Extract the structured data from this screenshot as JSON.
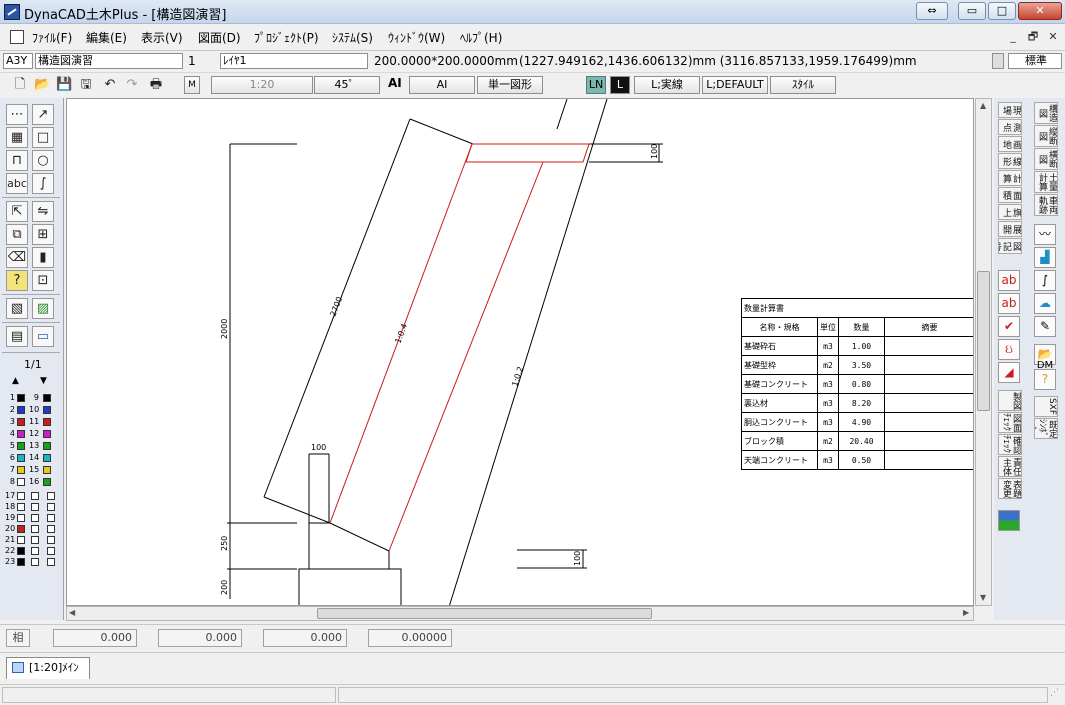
{
  "window": {
    "title": "DynaCAD土木Plus - [構造図演習]",
    "controls": {
      "restore": "⇔",
      "minimize": "▭",
      "maximize": "□",
      "close": "✕"
    }
  },
  "menu": {
    "items": [
      "ﾌｧｲﾙ(F)",
      "編集(E)",
      "表示(V)",
      "図面(D)",
      "ﾌﾟﾛｼﾞｪｸﾄ(P)",
      "ｼｽﾃﾑ(S)",
      "ｳｨﾝﾄﾞｳ(W)",
      "ﾍﾙﾌﾟ(H)"
    ],
    "mdi": [
      "_",
      "🗗",
      "✕"
    ]
  },
  "info": {
    "paper": "A3Y",
    "drawing": "構造図演習",
    "layer_no": "1",
    "layer": "ﾚｲﾔ1",
    "scale_size": "200.0000*200.0000mm",
    "coords": "(1227.949162,1436.606132)mm (3116.857133,1959.176499)mm",
    "style": "標準"
  },
  "toolbar": {
    "m_label": "M",
    "scale": "1:20",
    "angle": "45゜",
    "ai_label": "AI",
    "ai_button": "AI",
    "single_shape": "単一図形",
    "ln": "LN",
    "l": "L",
    "line_type": "L;実線",
    "line_default": "L;DEFAULT",
    "style_button": "ｽﾀｲﾙ"
  },
  "left_palette": {
    "page": "1/1",
    "colors": [
      {
        "n": "1",
        "c": "#000000",
        "n2": "9",
        "c2": "#000000"
      },
      {
        "n": "2",
        "c": "#1e3cc8",
        "n2": "10",
        "c2": "#1e3cc8"
      },
      {
        "n": "3",
        "c": "#c81e1e",
        "n2": "11",
        "c2": "#c81e1e"
      },
      {
        "n": "4",
        "c": "#c81ec8",
        "n2": "12",
        "c2": "#c81ec8"
      },
      {
        "n": "5",
        "c": "#1ea01e",
        "n2": "13",
        "c2": "#1ea01e"
      },
      {
        "n": "6",
        "c": "#1eb4c8",
        "n2": "14",
        "c2": "#1eb4c8"
      },
      {
        "n": "7",
        "c": "#e6c81e",
        "n2": "15",
        "c2": "#e6c81e"
      },
      {
        "n": "8",
        "c": "#ffffff",
        "n2": "16",
        "c2": "#1ea01e"
      }
    ],
    "layers": [
      {
        "n": "17",
        "c": "#ffffff"
      },
      {
        "n": "18",
        "c": "#ffffff"
      },
      {
        "n": "19",
        "c": "#ffffff"
      },
      {
        "n": "20",
        "c": "#c81e1e"
      },
      {
        "n": "21",
        "c": "#ffffff"
      },
      {
        "n": "22",
        "c": "#000000"
      },
      {
        "n": "23",
        "c": "#000000"
      }
    ]
  },
  "right_palette": {
    "col1": [
      "現場",
      "測点",
      "画地",
      "線形",
      "計算",
      "面積",
      "旗上",
      "展開",
      "図記号"
    ],
    "col2": [
      "構造図",
      "縦断図",
      "横断図",
      "土量計算",
      "車両軌跡"
    ],
    "lower1": [
      "製図",
      "図面ﾁｪｯｸ",
      "確認ﾁｪｯｸ",
      "責任主体",
      "表題変更"
    ],
    "lower2": [
      "SXF",
      "既定ｼﾝﾎﾞﾙ"
    ],
    "dm": "DM"
  },
  "drawing": {
    "dims": {
      "total_height": "2000",
      "slope_length": "2700",
      "slope_left": "1:0.4",
      "slope_right": "1:0.2",
      "top_height": "100",
      "crest_width": "100",
      "footing": "250",
      "base": "200",
      "right_low": "100"
    }
  },
  "quantity_table": {
    "title": "数量計算書",
    "headers": [
      "名称・規格",
      "単位",
      "数量",
      "摘要"
    ],
    "rows": [
      {
        "name": "基礎砕石",
        "unit": "m3",
        "qty": "1.00",
        "note": ""
      },
      {
        "name": "基礎型枠",
        "unit": "m2",
        "qty": "3.50",
        "note": ""
      },
      {
        "name": "基礎コンクリート",
        "unit": "m3",
        "qty": "0.80",
        "note": ""
      },
      {
        "name": "裏込材",
        "unit": "m3",
        "qty": "8.20",
        "note": ""
      },
      {
        "name": "胴込コンクリート",
        "unit": "m3",
        "qty": "4.90",
        "note": ""
      },
      {
        "name": "ブロック積",
        "unit": "m2",
        "qty": "20.40",
        "note": ""
      },
      {
        "name": "天端コンクリート",
        "unit": "m3",
        "qty": "0.50",
        "note": ""
      }
    ]
  },
  "coordbar": {
    "label": "相",
    "values": [
      "0.000",
      "0.000",
      "0.000",
      "0.00000"
    ]
  },
  "tabs": [
    {
      "label": "[1:20]ﾒｲﾝ"
    }
  ]
}
